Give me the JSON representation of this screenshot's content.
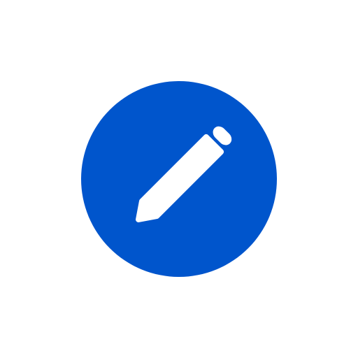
{
  "edit_button": {
    "icon": "pencil-icon",
    "background_color": "#0055CC",
    "icon_color": "#FFFFFF"
  },
  "page": {
    "background_color": "#FFFFFF"
  }
}
